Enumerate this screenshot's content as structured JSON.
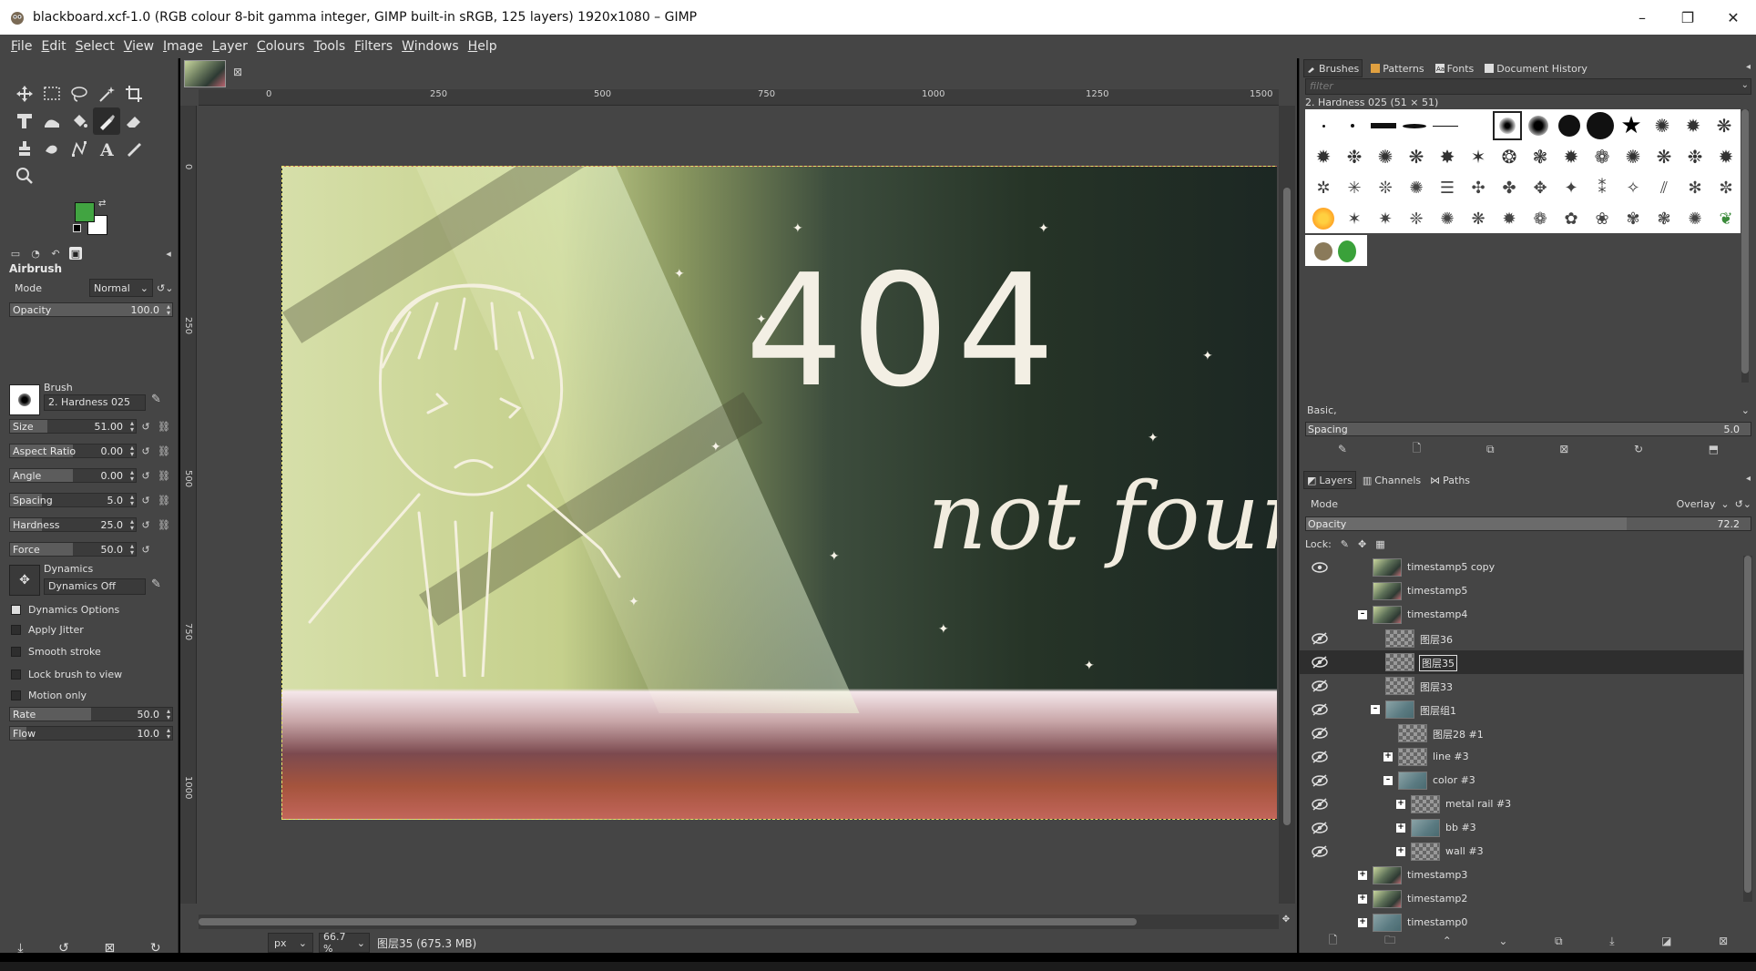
{
  "window": {
    "title": "blackboard.xcf-1.0 (RGB colour 8-bit gamma integer, GIMP built-in sRGB, 125 layers) 1920x1080 – GIMP",
    "minimize": "–",
    "maximize": "❐",
    "close": "✕"
  },
  "menu": [
    {
      "u": "F",
      "rest": "ile"
    },
    {
      "u": "E",
      "rest": "dit"
    },
    {
      "u": "S",
      "rest": "elect"
    },
    {
      "u": "V",
      "rest": "iew"
    },
    {
      "u": "I",
      "rest": "mage"
    },
    {
      "u": "L",
      "rest": "ayer"
    },
    {
      "u": "C",
      "rest": "olours"
    },
    {
      "u": "T",
      "rest": "ools"
    },
    {
      "u": "F",
      "rest": "ilters"
    },
    {
      "u": "W",
      "rest": "indows"
    },
    {
      "u": "H",
      "rest": "elp"
    }
  ],
  "toolOptions": {
    "title": "Airbrush",
    "modeLabel": "Mode",
    "modeValue": "Normal",
    "opacity": {
      "label": "Opacity",
      "value": "100.0"
    },
    "brushLabel": "Brush",
    "brushName": "2. Hardness 025",
    "size": {
      "label": "Size",
      "value": "51.00"
    },
    "aspect": {
      "label": "Aspect Ratio",
      "value": "0.00"
    },
    "angle": {
      "label": "Angle",
      "value": "0.00"
    },
    "spacing": {
      "label": "Spacing",
      "value": "5.0"
    },
    "hardness": {
      "label": "Hardness",
      "value": "25.0"
    },
    "force": {
      "label": "Force",
      "value": "50.0"
    },
    "dynamicsLabel": "Dynamics",
    "dynamicsName": "Dynamics Off",
    "dynamicsOptions": "Dynamics Options",
    "applyJitter": "Apply Jitter",
    "smoothStroke": "Smooth stroke",
    "lockBrush": "Lock brush to view",
    "motionOnly": "Motion only",
    "rate": {
      "label": "Rate",
      "value": "50.0"
    },
    "flow": {
      "label": "Flow",
      "value": "10.0"
    }
  },
  "colors": {
    "fg": "#41a441",
    "bg": "#ffffff"
  },
  "canvas": {
    "text404": "404",
    "textNotFound": "not found",
    "rulerH": [
      "0",
      "250",
      "500",
      "750",
      "1000",
      "1250",
      "1500"
    ],
    "rulerV": [
      "0",
      "250",
      "500",
      "750",
      "1000"
    ]
  },
  "status": {
    "unit": "px",
    "zoom": "66.7 %",
    "text": "图层35 (675.3 MB)"
  },
  "brushes": {
    "tabs": [
      "Brushes",
      "Patterns",
      "Fonts",
      "Document History"
    ],
    "filterPlaceholder": "filter",
    "current": "2. Hardness 025 (51 × 51)",
    "tagSelect": "Basic,",
    "spacingLabel": "Spacing",
    "spacingValue": "5.0"
  },
  "layers": {
    "tabs": [
      "Layers",
      "Channels",
      "Paths"
    ],
    "modeLabel": "Mode",
    "modeValue": "Overlay",
    "opacityLabel": "Opacity",
    "opacityValue": "72.2",
    "lockLabel": "Lock:",
    "items": [
      {
        "name": "timestamp5 copy",
        "eye": "open",
        "thumb": "img"
      },
      {
        "name": "timestamp5",
        "eye": "none",
        "thumb": "img"
      },
      {
        "name": "timestamp4",
        "eye": "none",
        "thumb": "img",
        "expander": "–"
      },
      {
        "name": "图层36",
        "eye": "closed",
        "thumb": "chk"
      },
      {
        "name": "图层35",
        "eye": "closed",
        "thumb": "chk",
        "selected": true
      },
      {
        "name": "图层33",
        "eye": "closed",
        "thumb": "chk"
      },
      {
        "name": "图层组1",
        "eye": "closed",
        "thumb": "teal",
        "expander": "–"
      },
      {
        "name": "图层28 #1",
        "eye": "closed",
        "thumb": "chk"
      },
      {
        "name": "line #3",
        "eye": "closed",
        "thumb": "chk",
        "expander": "+"
      },
      {
        "name": "color #3",
        "eye": "closed",
        "thumb": "teal",
        "expander": "–"
      },
      {
        "name": "metal rail #3",
        "eye": "closed",
        "thumb": "chk",
        "expander": "+"
      },
      {
        "name": "bb #3",
        "eye": "closed",
        "thumb": "teal",
        "expander": "+"
      },
      {
        "name": "wall #3",
        "eye": "closed",
        "thumb": "chk",
        "expander": "+"
      },
      {
        "name": "timestamp3",
        "eye": "none",
        "thumb": "img",
        "expander": "+"
      },
      {
        "name": "timestamp2",
        "eye": "none",
        "thumb": "img",
        "expander": "+"
      },
      {
        "name": "timestamp0",
        "eye": "none",
        "thumb": "teal",
        "expander": "+"
      }
    ]
  }
}
